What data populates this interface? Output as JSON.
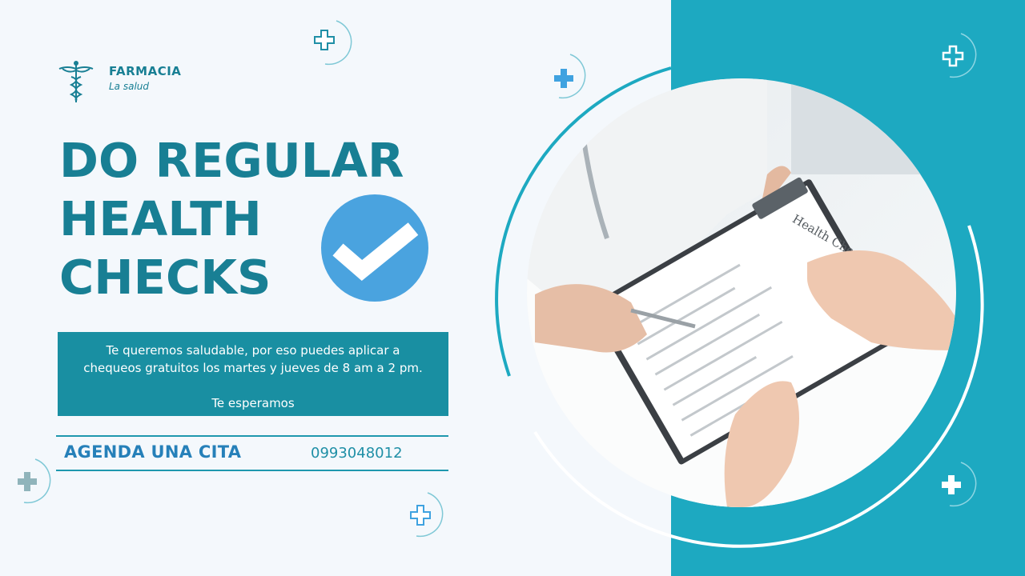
{
  "brand": {
    "name": "FARMACIA",
    "tagline": "La salud"
  },
  "headline": {
    "lines": [
      "DO REGULAR",
      "HEALTH",
      "CHECKS"
    ]
  },
  "info": {
    "line1": "Te queremos saludable, por eso puedes aplicar a",
    "line2": "chequeos gratuitos los martes y jueves de 8 am a 2 pm.",
    "closing": "Te esperamos"
  },
  "cta": {
    "label": "AGENDA UNA CITA",
    "phone": "0993048012"
  },
  "photo": {
    "clipboard_title": "Health Check"
  },
  "icons": [
    "caduceus-icon",
    "check-icon",
    "plus-icon"
  ],
  "colors": {
    "background": "#f4f8fc",
    "teal_panel": "#1da9c1",
    "headline": "#187f94",
    "info_box": "#198fa2",
    "cta": "#2680b9",
    "check_badge": "#4aa3df"
  }
}
